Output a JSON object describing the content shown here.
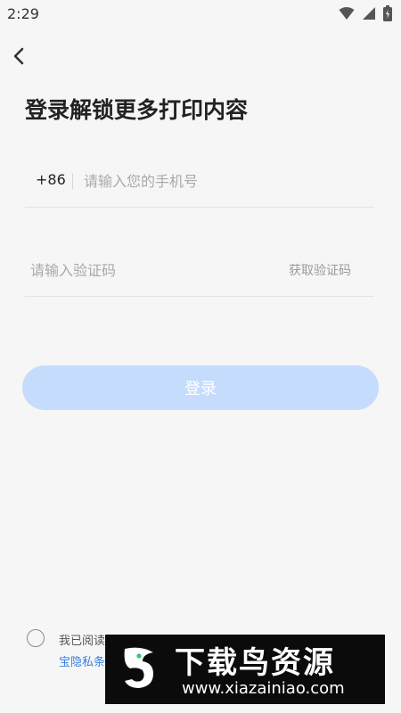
{
  "status_bar": {
    "time": "2:29"
  },
  "page": {
    "title": "登录解锁更多打印内容"
  },
  "phone": {
    "country_code": "+86",
    "placeholder": "请输入您的手机号"
  },
  "code": {
    "placeholder": "请输入验证码",
    "get_code_label": "获取验证码"
  },
  "login_button": {
    "label": "登录"
  },
  "agreement": {
    "line1": "我已阅读",
    "line2": "宝隐私条"
  },
  "watermark": {
    "title": "下载鸟资源",
    "url": "www.xiazainiao.com"
  },
  "colors": {
    "primary_disabled": "#c6dcfd",
    "link": "#3b7fe2",
    "background": "#f6f6f6"
  },
  "icons": [
    "wifi-icon",
    "signal-icon",
    "battery-icon",
    "back-arrow-icon"
  ]
}
